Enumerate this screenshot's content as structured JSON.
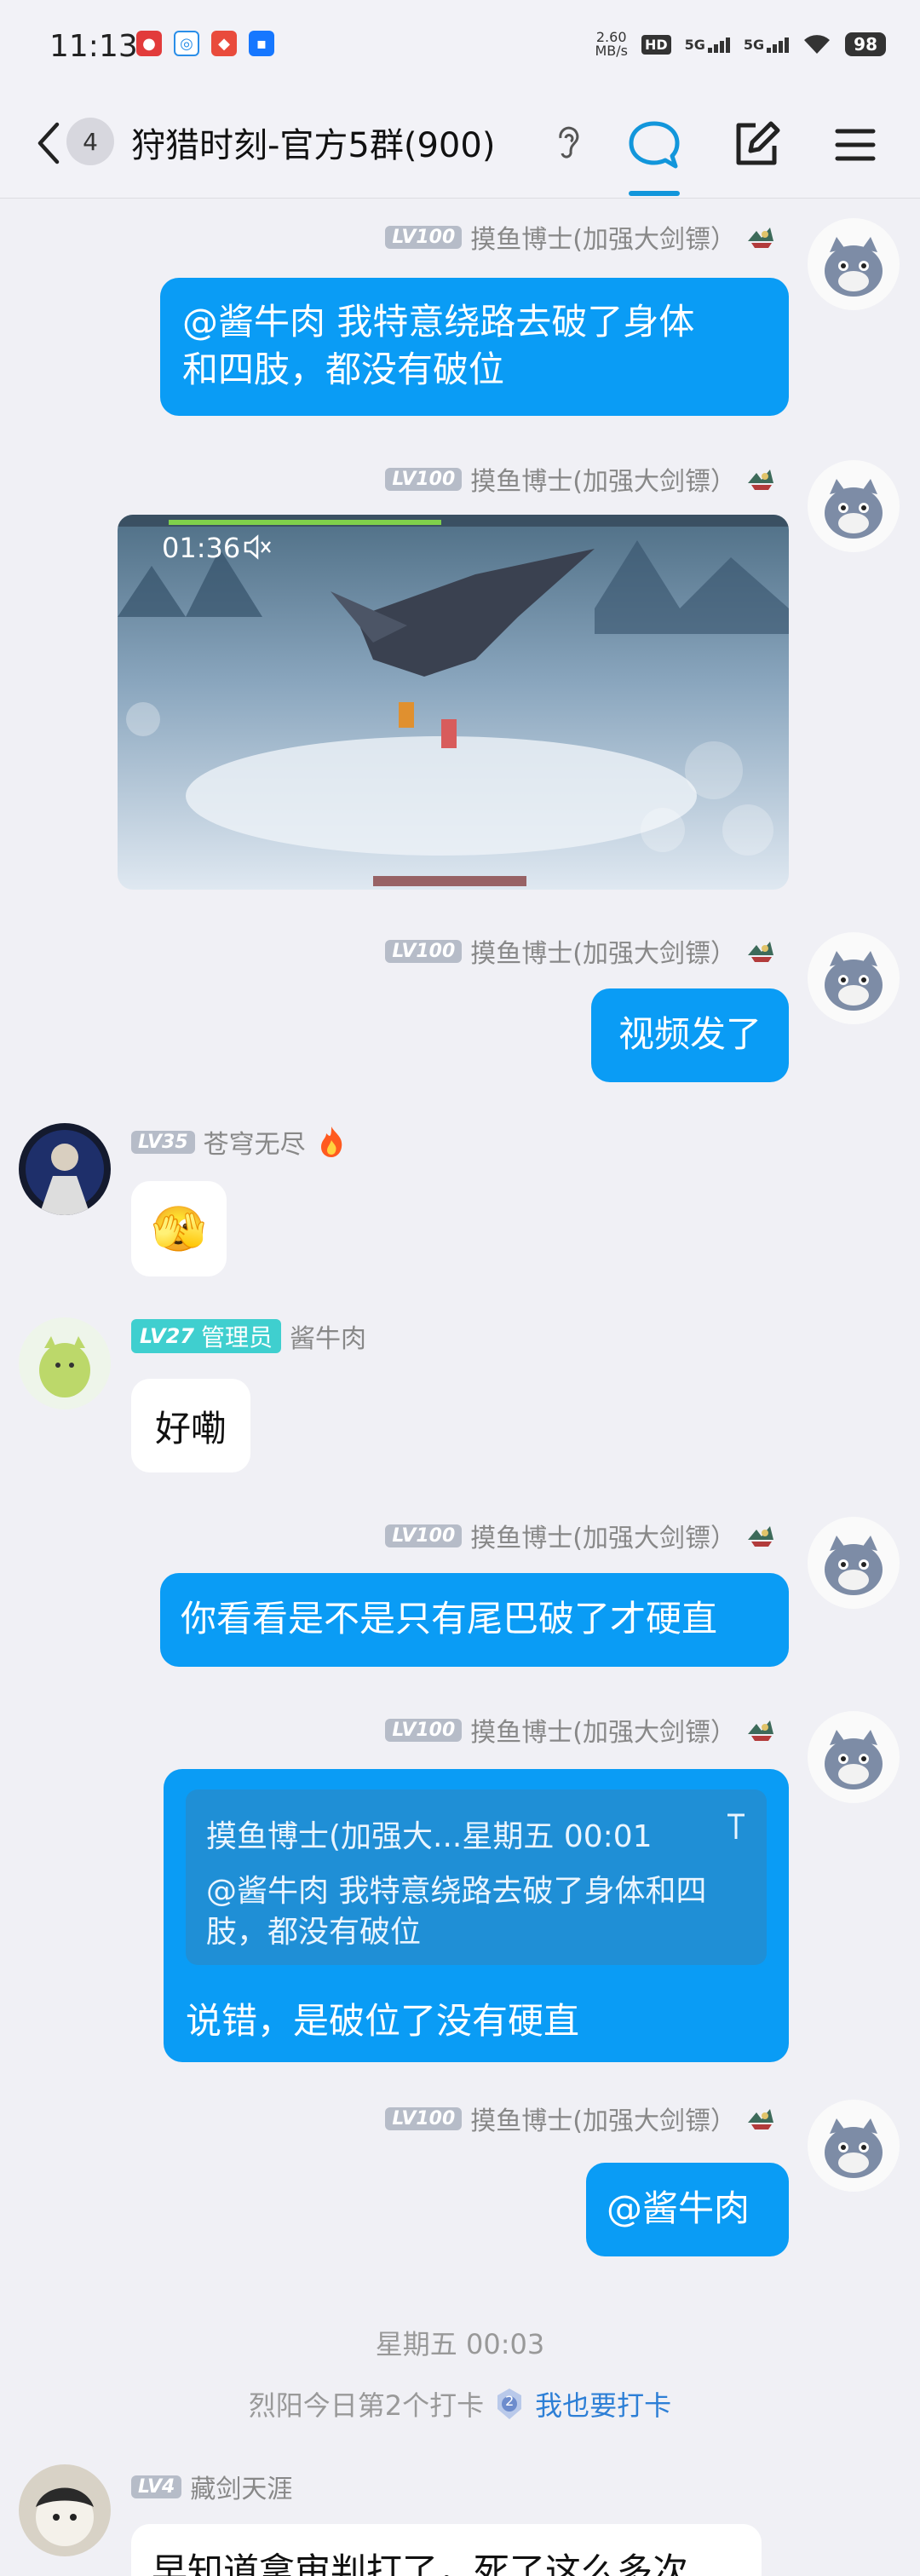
{
  "status_bar": {
    "time": "11:13",
    "net_speed_value": "2.60",
    "net_speed_unit": "MB/s",
    "hd": "HD",
    "sim1": "5G",
    "sim2": "5G",
    "battery": "98"
  },
  "header": {
    "unread_count": "4",
    "title": "狩猎时刻-官方5群(900)"
  },
  "messages": [
    {
      "id": "m1",
      "sender": "摸鱼博士(加强大剑镖）",
      "level": "LV100",
      "text": "@酱牛肉 我特意绕路去破了身体和四肢，都没有破位",
      "line1": "@酱牛肉 我特意绕路去破了身体",
      "line2": "和四肢，都没有破位"
    },
    {
      "id": "m2",
      "sender": "摸鱼博士(加强大剑镖）",
      "level": "LV100",
      "type": "video",
      "video_time": "01:36"
    },
    {
      "id": "m3",
      "sender": "摸鱼博士(加强大剑镖）",
      "level": "LV100",
      "text": "视频发了"
    },
    {
      "id": "m4",
      "sender": "苍穹无尽",
      "level": "LV35",
      "text": "🫣"
    },
    {
      "id": "m5",
      "sender": "酱牛肉",
      "level": "LV27",
      "role": "管理员",
      "text": "好嘞"
    },
    {
      "id": "m6",
      "sender": "摸鱼博士(加强大剑镖）",
      "level": "LV100",
      "text": "你看看是不是只有尾巴破了才硬直"
    },
    {
      "id": "m7",
      "sender": "摸鱼博士(加强大剑镖）",
      "level": "LV100",
      "quote": {
        "header": "摸鱼博士(加强大...星期五 00:01",
        "line1": "@酱牛肉 我特意绕路去破了身体和四",
        "line2": "肢，都没有破位"
      },
      "text": "说错，是破位了没有硬直"
    },
    {
      "id": "m8",
      "sender": "摸鱼博士(加强大剑镖）",
      "level": "LV100",
      "text": "@酱牛肉"
    },
    {
      "id": "m9",
      "sender": "藏剑天涯",
      "level": "LV4",
      "text": "早知道拿审判打了，死了这么多次"
    }
  ],
  "system": {
    "time_divider": "星期五 00:03",
    "checkin_text": "烈阳今日第2个打卡",
    "checkin_badge": "2",
    "checkin_link": "我也要打卡"
  },
  "colors": {
    "my_bubble": "#0a9cf5",
    "accent": "#1296db",
    "background": "#f0f0f5",
    "admin_badge": "#3fcfcf"
  },
  "icons": [
    "back-icon",
    "ear-icon",
    "chat-bubble-icon",
    "edit-icon",
    "menu-icon",
    "title-badge-icon",
    "fire-icon",
    "mute-icon",
    "checkin-medal-icon"
  ]
}
